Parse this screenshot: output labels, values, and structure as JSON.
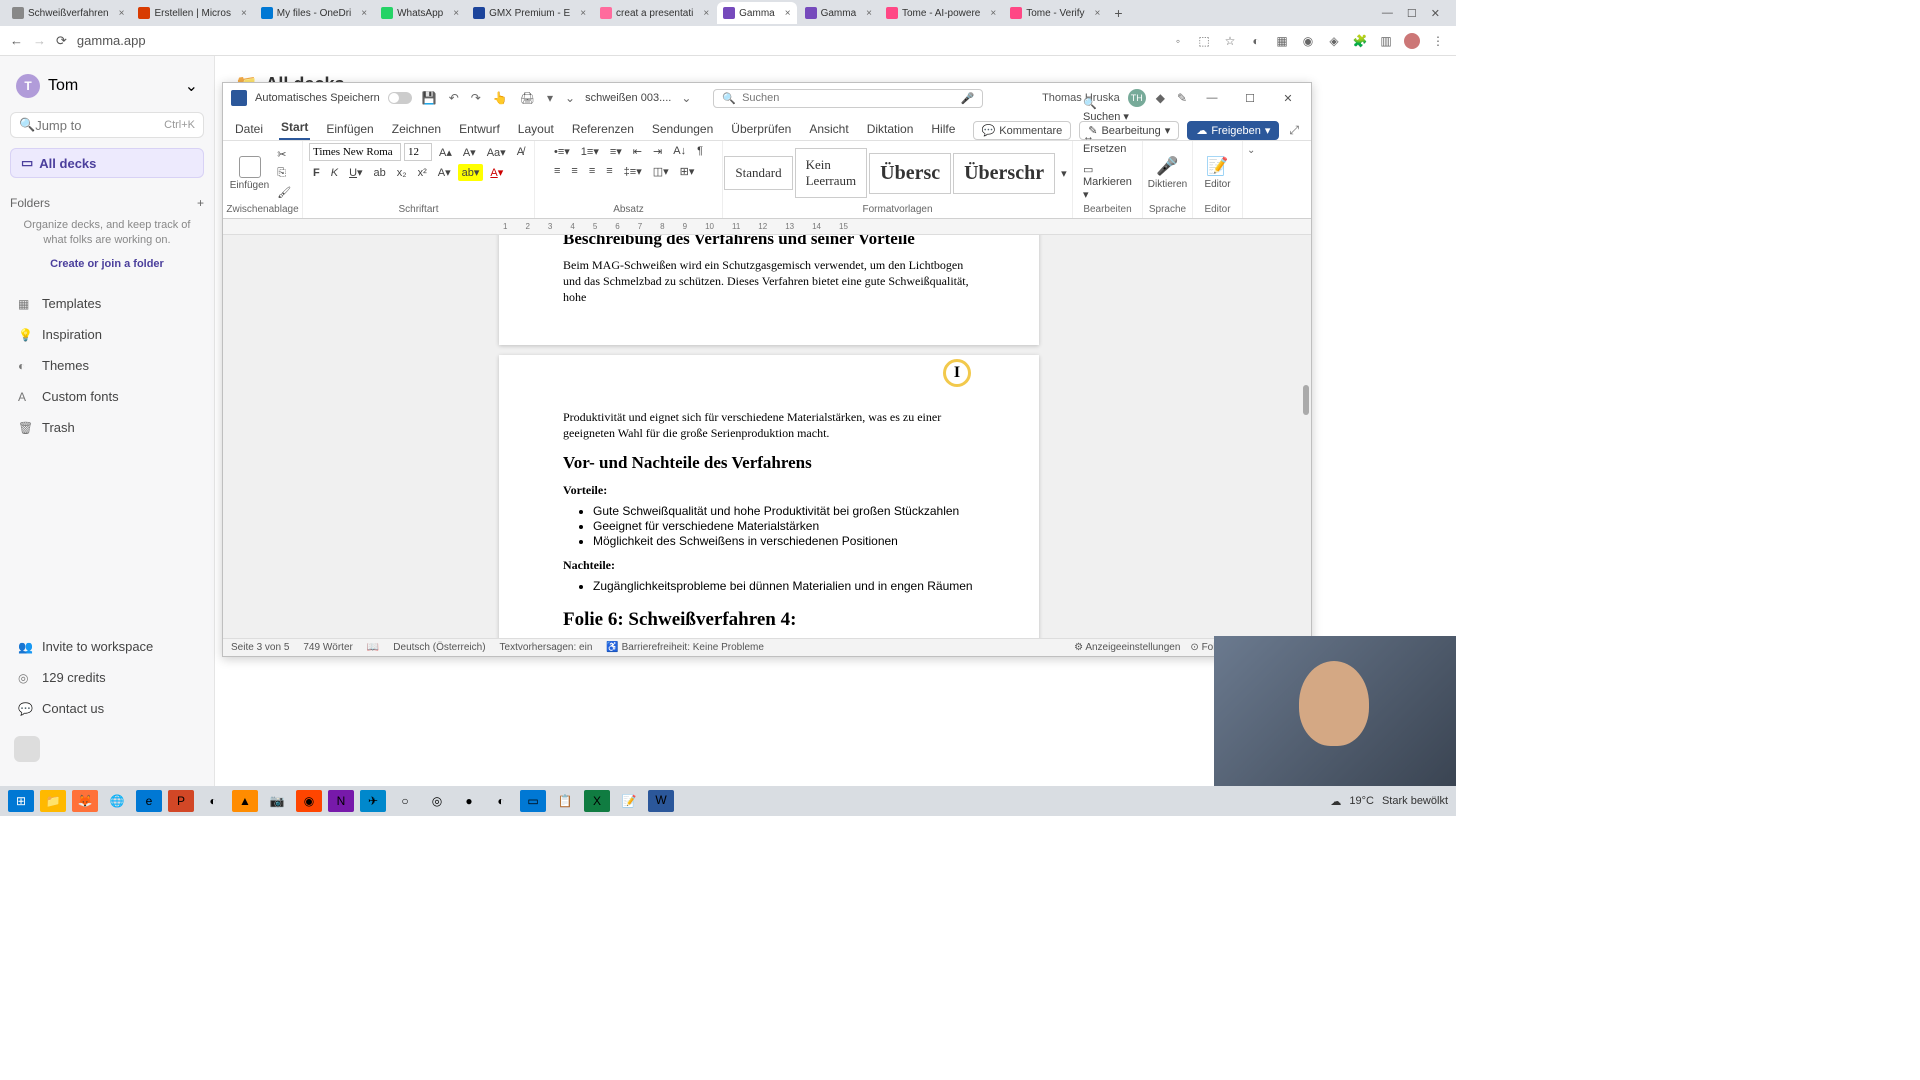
{
  "browser": {
    "tabs": [
      {
        "label": "Schweißverfahren",
        "icon": "#888"
      },
      {
        "label": "Erstellen | Micros",
        "icon": "#d83b01"
      },
      {
        "label": "My files - OneDri",
        "icon": "#0078d4"
      },
      {
        "label": "WhatsApp",
        "icon": "#25d366"
      },
      {
        "label": "GMX Premium - E",
        "icon": "#1c449b"
      },
      {
        "label": "creat a presentati",
        "icon": "#ff6b9d"
      },
      {
        "label": "Gamma",
        "icon": "#764abc",
        "active": true
      },
      {
        "label": "Gamma",
        "icon": "#764abc"
      },
      {
        "label": "Tome - AI-powere",
        "icon": "#ff4785"
      },
      {
        "label": "Tome - Verify",
        "icon": "#ff4785"
      }
    ],
    "url": "gamma.app"
  },
  "gamma": {
    "user_initial": "T",
    "user_name": "Tom",
    "search_placeholder": "Jump to",
    "search_hint": "Ctrl+K",
    "all_decks": "All decks",
    "folders_label": "Folders",
    "help_text": "Organize decks, and keep track of what folks are working on.",
    "join_link": "Create or join a folder",
    "nav": {
      "templates": "Templates",
      "inspiration": "Inspiration",
      "themes": "Themes",
      "customfonts": "Custom fonts",
      "trash": "Trash"
    },
    "bottom": {
      "invite": "Invite to workspace",
      "credits": "129 credits",
      "contact": "Contact us"
    },
    "header": "All decks"
  },
  "word": {
    "autosave_label": "Automatisches Speichern",
    "filename": "schweißen 003....",
    "search_placeholder": "Suchen",
    "user": "Thomas Hruska",
    "user_initials": "TH",
    "tabs": {
      "datei": "Datei",
      "start": "Start",
      "einfuegen": "Einfügen",
      "zeichnen": "Zeichnen",
      "entwurf": "Entwurf",
      "layout": "Layout",
      "referenzen": "Referenzen",
      "sendungen": "Sendungen",
      "ueberpruefen": "Überprüfen",
      "ansicht": "Ansicht",
      "diktieren": "Diktation",
      "hilfe": "Hilfe"
    },
    "toolbar": {
      "kommentare": "Kommentare",
      "bearbeitung": "Bearbeitung",
      "freigeben": "Freigeben"
    },
    "ribbon": {
      "zwischenablage": "Zwischenablage",
      "einfuegen": "Einfügen",
      "schriftart": "Schriftart",
      "font_name": "Times New Roma",
      "font_size": "12",
      "absatz": "Absatz",
      "formatvorlagen": "Formatvorlagen",
      "style1": "Standard",
      "style2": "Kein Leerraum",
      "style3": "Übersc",
      "style4": "Überschr",
      "bearbeiten": "Bearbeiten",
      "suchen": "Suchen",
      "ersetzen": "Ersetzen",
      "markieren": "Markieren",
      "sprache": "Sprache",
      "diktieren": "Diktieren",
      "editor": "Editor"
    },
    "doc": {
      "h1": "Beschreibung des Verfahrens und seiner Vorteile",
      "p1": "Beim MAG-Schweißen wird ein Schutzgasgemisch verwendet, um den Lichtbogen und das Schmelzbad zu schützen. Dieses Verfahren bietet eine gute Schweißqualität, hohe",
      "p2": "Produktivität und eignet sich für verschiedene Materialstärken, was es zu einer geeigneten Wahl für die große Serienproduktion macht.",
      "h2": "Vor- und Nachteile des Verfahrens",
      "vorteile": "Vorteile:",
      "v1": "Gute Schweißqualität und hohe Produktivität bei großen Stückzahlen",
      "v2": "Geeignet für verschiedene Materialstärken",
      "v3": "Möglichkeit des Schweißens in verschiedenen Positionen",
      "nachteile": "Nachteile:",
      "n1": "Zugänglichkeitsprobleme bei dünnen Materialien und in engen Räumen",
      "h3": "Folie 6: Schweißverfahren 4:"
    },
    "status": {
      "page": "Seite 3 von 5",
      "words": "749 Wörter",
      "lang": "Deutsch (Österreich)",
      "predict": "Textvorhersagen: ein",
      "access": "Barrierefreiheit: Keine Probleme",
      "display": "Anzeigeeinstellungen",
      "fokus": "Fokus"
    }
  },
  "taskbar": {
    "temp": "19°C",
    "weather": "Stark bewölkt"
  }
}
